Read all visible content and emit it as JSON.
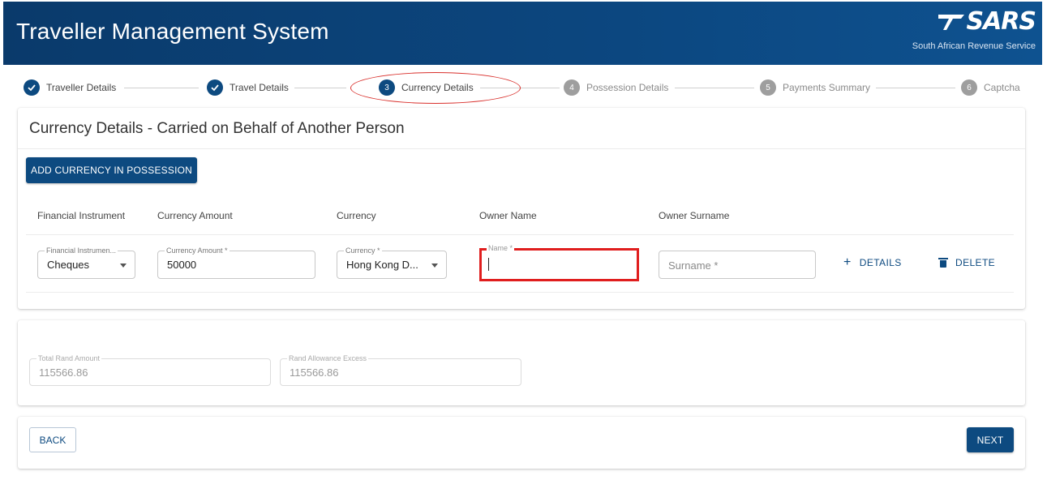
{
  "header": {
    "title": "Traveller Management System",
    "logo_text": "SARS",
    "logo_subtitle": "South African Revenue Service"
  },
  "stepper": {
    "steps": [
      {
        "number": "1",
        "label": "Traveller Details",
        "state": "done"
      },
      {
        "number": "2",
        "label": "Travel Details",
        "state": "done"
      },
      {
        "number": "3",
        "label": "Currency Details",
        "state": "active"
      },
      {
        "number": "4",
        "label": "Possession Details",
        "state": "pending"
      },
      {
        "number": "5",
        "label": "Payments Summary",
        "state": "pending"
      },
      {
        "number": "6",
        "label": "Captcha",
        "state": "pending"
      }
    ]
  },
  "currency_section": {
    "title": "Currency Details - Carried on Behalf of Another Person",
    "add_button": "ADD CURRENCY IN POSSESSION",
    "columns": [
      "Financial Instrument",
      "Currency Amount",
      "Currency",
      "Owner Name",
      "Owner Surname"
    ],
    "row": {
      "financial_instrument_label": "Financial Instrumen...",
      "financial_instrument_value": "Cheques",
      "currency_amount_label": "Currency Amount *",
      "currency_amount_value": "50000",
      "currency_label": "Currency *",
      "currency_value": "Hong Kong D...",
      "owner_name_label": "Name *",
      "owner_name_value": "",
      "owner_surname_placeholder": "Surname *",
      "details_label": "DETAILS",
      "delete_label": "DELETE"
    }
  },
  "totals": {
    "total_rand_label": "Total Rand Amount",
    "total_rand_value": "115566.86",
    "excess_label": "Rand Allowance Excess",
    "excess_value": "115566.86"
  },
  "navigation": {
    "back_label": "BACK",
    "next_label": "NEXT"
  },
  "colors": {
    "primary": "#0d4a80",
    "header_bg": "#0c4780",
    "highlight": "#e01e1e"
  }
}
